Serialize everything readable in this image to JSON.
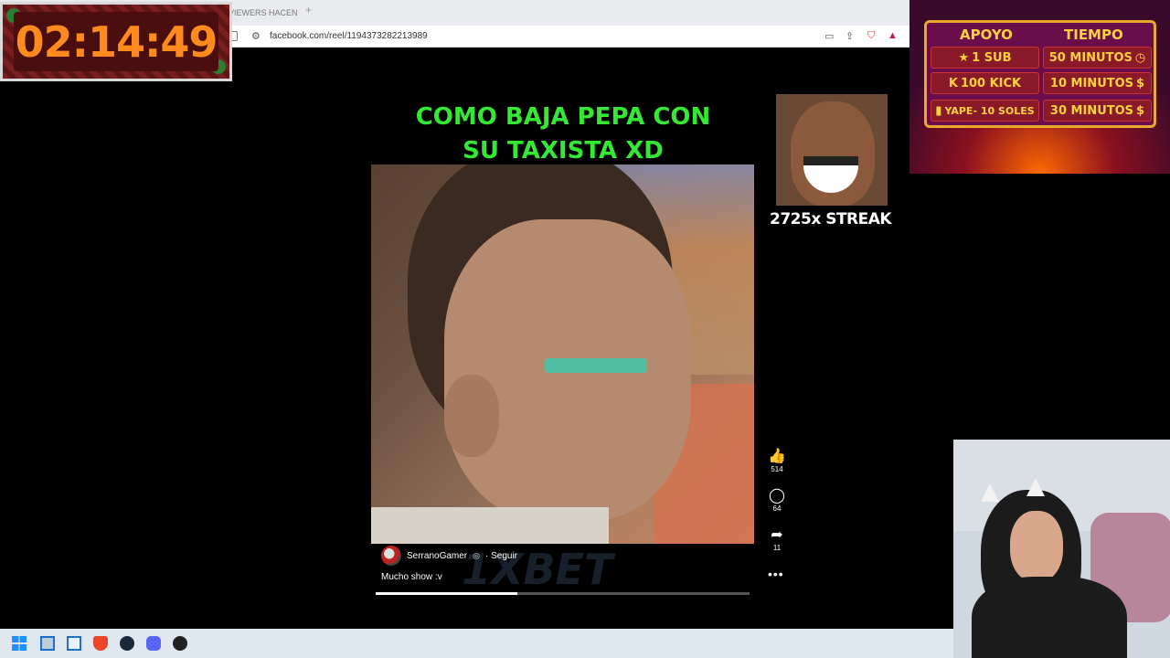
{
  "browser": {
    "tab_title": "VIEWERS HACEN",
    "tab_new": "+",
    "url": "facebook.com/reel/1194373282213989"
  },
  "timer": {
    "value": "02:14:49"
  },
  "reel": {
    "title_line1": "COMO BAJA PEPA CON",
    "title_line2": "SU TAXISTA XD",
    "author": "SerranoGamer",
    "verified_symbol": "·",
    "follow_label": "· Seguir",
    "caption": "Mucho show :v",
    "watermark": "1XBET",
    "progress_fraction": 0.38,
    "actions": {
      "likes": "514",
      "comments": "64",
      "shares": "11",
      "more": "•••"
    }
  },
  "overlay": {
    "streak": "2725x STREAK"
  },
  "support_panel": {
    "header_left": "APOYO",
    "header_right": "TIEMPO",
    "rows": [
      {
        "left": "1 SUB",
        "left_icon": "★",
        "right": "50 MINUTOS",
        "right_icon": "◷"
      },
      {
        "left": "100 KICK",
        "left_icon": "K",
        "right": "10 MINUTOS",
        "right_icon": "$"
      },
      {
        "left": "YAPE- 10 SOLES",
        "left_icon": "▮",
        "right": "30 MINUTOS",
        "right_icon": "$"
      }
    ]
  },
  "colors": {
    "title_green": "#34e834",
    "timer_orange": "#ff8a1e",
    "panel_gold": "#ffd23c"
  },
  "icons": {
    "like": "thumbs-up-icon",
    "comment": "comment-icon",
    "share": "share-icon"
  }
}
